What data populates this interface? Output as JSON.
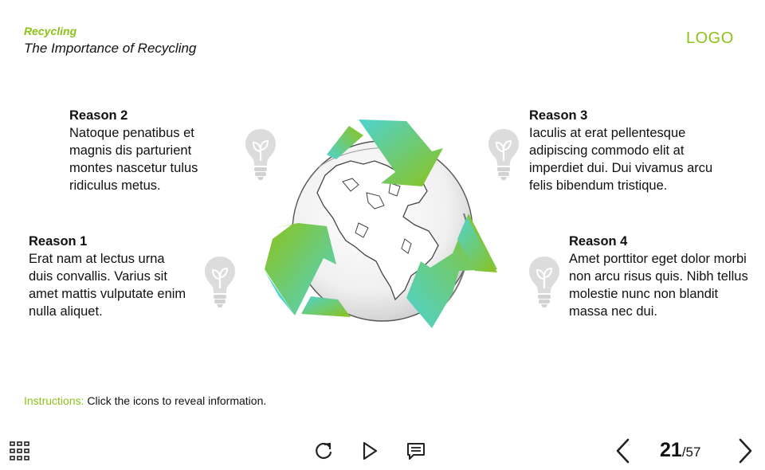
{
  "header": {
    "course": "Recycling",
    "title": "The Importance of Recycling",
    "logo": "LOGO"
  },
  "reasons": [
    {
      "title": "Reason 1",
      "text": "Erat nam at lectus urna duis convallis. Varius sit amet mattis vulputate enim nulla aliquet."
    },
    {
      "title": "Reason 2",
      "text": "Natoque penatibus et magnis dis parturient montes nascetur tulus ridiculus metus."
    },
    {
      "title": "Reason 3",
      "text": "Iaculis at erat pellentesque adipiscing commodo elit at imperdiet dui. Dui vivamus arcu felis bibendum tristique."
    },
    {
      "title": "Reason 4",
      "text": "Amet porttitor eget dolor morbi non arcu risus quis. Nibh tellus molestie nunc non blandit massa nec dui."
    }
  ],
  "instructions": {
    "label": "Instructions:",
    "text": " Click the icons to reveal information."
  },
  "player": {
    "current_page": "21",
    "total_pages": "/57",
    "icons": [
      "grid-menu-icon",
      "replay-icon",
      "play-icon",
      "notes-icon",
      "chevron-left-icon",
      "chevron-right-icon",
      "lightbulb-icon",
      "recycle-globe-icon"
    ]
  },
  "colors": {
    "accent": "#8cc21a",
    "teal": "#4fd3d0",
    "bulb": "#d8d8d8",
    "text": "#111111"
  }
}
